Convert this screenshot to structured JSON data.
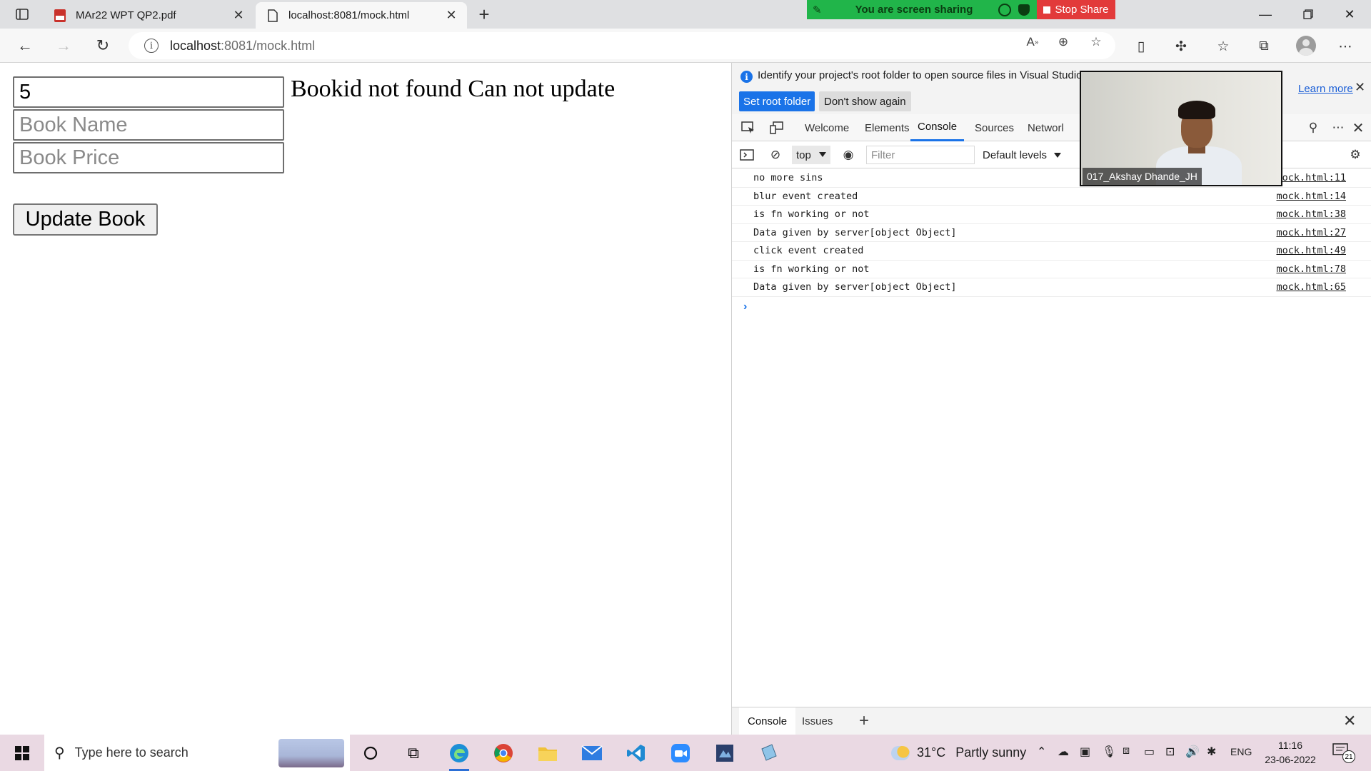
{
  "browser": {
    "tabs": [
      {
        "title": "MAr22 WPT QP2.pdf",
        "close": "✕"
      },
      {
        "title": "localhost:8081/mock.html",
        "close": "✕"
      }
    ],
    "url_host": "localhost",
    "url_rest": ":8081/mock.html"
  },
  "screen_share": {
    "status": "You are screen sharing",
    "stop_label": "Stop Share"
  },
  "page": {
    "book_id_value": "5",
    "book_name_placeholder": "Book Name",
    "book_price_placeholder": "Book Price",
    "message": "Bookid not found Can not update",
    "update_button": "Update Book"
  },
  "devtools": {
    "infobar_text": "Identify your project's root folder to open source files in Visual Studio Code",
    "set_root_label": "Set root folder",
    "dont_show_label": "Don't show again",
    "learn_more_label": "Learn more",
    "tabs": [
      "Welcome",
      "Elements",
      "Console",
      "Sources",
      "Network"
    ],
    "active_tab": "Console",
    "context": "top",
    "filter_placeholder": "Filter",
    "levels": "Default levels",
    "logs": [
      {
        "msg": "no more sins",
        "src": "mock.html:11"
      },
      {
        "msg": "blur event created",
        "src": "mock.html:14"
      },
      {
        "msg": "is fn working or not",
        "src": "mock.html:38"
      },
      {
        "msg": "Data given by server[object Object]",
        "src": "mock.html:27"
      },
      {
        "msg": "click event created",
        "src": "mock.html:49"
      },
      {
        "msg": "is fn working or not",
        "src": "mock.html:78"
      },
      {
        "msg": "Data given by server[object Object]",
        "src": "mock.html:65"
      }
    ],
    "drawer_tabs": [
      "Console",
      "Issues"
    ]
  },
  "video": {
    "participant": "017_Akshay Dhande_JH"
  },
  "taskbar": {
    "search_placeholder": "Type here to search",
    "temperature": "31°C",
    "weather": "Partly sunny",
    "language": "ENG",
    "time": "11:16",
    "date": "23-06-2022",
    "notifications": "21"
  },
  "colors": {
    "accent": "#1a73e8",
    "share_green": "#21b54a",
    "stop_red": "#e23a3a"
  }
}
